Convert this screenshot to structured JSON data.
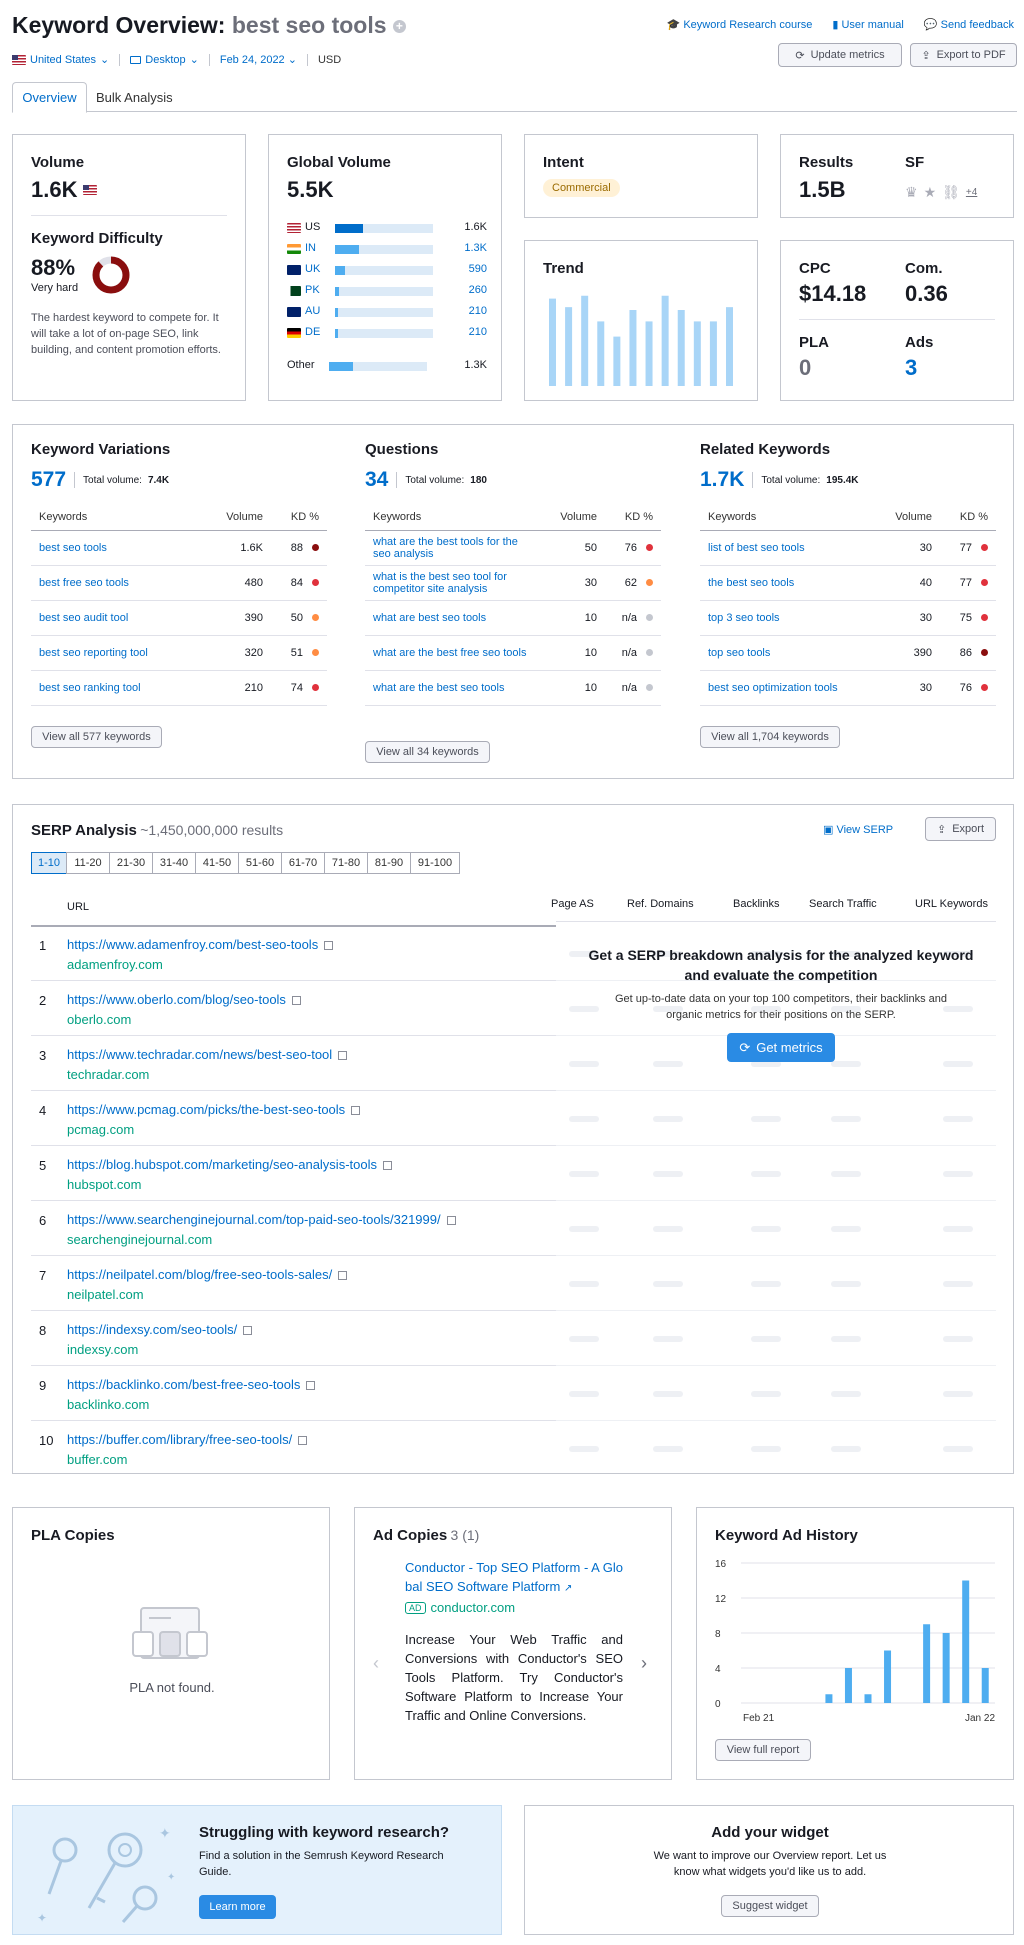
{
  "header": {
    "title_prefix": "Keyword Overview:",
    "keyword": "best seo tools",
    "links": {
      "course": "Keyword Research course",
      "manual": "User manual",
      "feedback": "Send feedback"
    },
    "filters": {
      "country": "United States",
      "device": "Desktop",
      "date": "Feb 24, 2022",
      "currency": "USD"
    },
    "buttons": {
      "update": "Update metrics",
      "export": "Export to PDF"
    },
    "tabs": [
      "Overview",
      "Bulk Analysis"
    ]
  },
  "volume": {
    "label": "Volume",
    "value": "1.6K",
    "kd_label": "Keyword Difficulty",
    "kd_value": "88%",
    "kd_level": "Very hard",
    "kd_percent": 88,
    "kd_desc": "The hardest keyword to compete for. It will take a lot of on-page SEO, link building, and content promotion efforts."
  },
  "global_volume": {
    "label": "Global Volume",
    "value": "5.5K",
    "countries": [
      {
        "code": "US",
        "value": "1.6K",
        "fill": 0.29,
        "link": false
      },
      {
        "code": "IN",
        "value": "1.3K",
        "fill": 0.24,
        "link": true
      },
      {
        "code": "UK",
        "value": "590",
        "fill": 0.1,
        "link": true
      },
      {
        "code": "PK",
        "value": "260",
        "fill": 0.04,
        "link": true
      },
      {
        "code": "AU",
        "value": "210",
        "fill": 0.035,
        "link": true
      },
      {
        "code": "DE",
        "value": "210",
        "fill": 0.035,
        "link": true
      }
    ],
    "other_label": "Other",
    "other_value": "1.3K",
    "other_fill": 0.24
  },
  "intent": {
    "label": "Intent",
    "badge": "Commercial"
  },
  "results": {
    "label": "Results",
    "value": "1.5B",
    "sf_label": "SF",
    "sf_more": "+4"
  },
  "trend": {
    "label": "Trend",
    "values": [
      0.92,
      0.83,
      0.95,
      0.68,
      0.52,
      0.8,
      0.68,
      0.95,
      0.8,
      0.68,
      0.68,
      0.83
    ]
  },
  "cpc": {
    "cpc_label": "CPC",
    "cpc_value": "$14.18",
    "com_label": "Com.",
    "com_value": "0.36",
    "pla_label": "PLA",
    "pla_value": "0",
    "ads_label": "Ads",
    "ads_value": "3"
  },
  "variations": {
    "label": "Keyword Variations",
    "count": "577",
    "total_label": "Total volume:",
    "total": "7.4K",
    "cols": [
      "Keywords",
      "Volume",
      "KD %"
    ],
    "rows": [
      {
        "k": "best seo tools",
        "v": "1.6K",
        "d": "88",
        "c": "#8A0E0E"
      },
      {
        "k": "best free seo tools",
        "v": "480",
        "d": "84",
        "c": "#E0323C"
      },
      {
        "k": "best seo audit tool",
        "v": "390",
        "d": "50",
        "c": "#FF8C43"
      },
      {
        "k": "best seo reporting tool",
        "v": "320",
        "d": "51",
        "c": "#FF8C43"
      },
      {
        "k": "best seo ranking tool",
        "v": "210",
        "d": "74",
        "c": "#E0323C"
      }
    ],
    "view_all": "View all 577 keywords"
  },
  "questions": {
    "label": "Questions",
    "count": "34",
    "total_label": "Total volume:",
    "total": "180",
    "cols": [
      "Keywords",
      "Volume",
      "KD %"
    ],
    "rows": [
      {
        "k": "what are the best tools for the seo analysis",
        "v": "50",
        "d": "76",
        "c": "#E0323C"
      },
      {
        "k": "what is the best seo tool for competitor site analysis",
        "v": "30",
        "d": "62",
        "c": "#FF8C43"
      },
      {
        "k": "what are best seo tools",
        "v": "10",
        "d": "n/a",
        "c": "#C4C7CF"
      },
      {
        "k": "what are the best free seo tools",
        "v": "10",
        "d": "n/a",
        "c": "#C4C7CF"
      },
      {
        "k": "what are the best seo tools",
        "v": "10",
        "d": "n/a",
        "c": "#C4C7CF"
      }
    ],
    "view_all": "View all 34 keywords"
  },
  "related": {
    "label": "Related Keywords",
    "count": "1.7K",
    "total_label": "Total volume:",
    "total": "195.4K",
    "cols": [
      "Keywords",
      "Volume",
      "KD %"
    ],
    "rows": [
      {
        "k": "list of best seo tools",
        "v": "30",
        "d": "77",
        "c": "#E0323C"
      },
      {
        "k": "the best seo tools",
        "v": "40",
        "d": "77",
        "c": "#E0323C"
      },
      {
        "k": "top 3 seo tools",
        "v": "30",
        "d": "75",
        "c": "#E0323C"
      },
      {
        "k": "top seo tools",
        "v": "390",
        "d": "86",
        "c": "#8A0E0E"
      },
      {
        "k": "best seo optimization tools",
        "v": "30",
        "d": "76",
        "c": "#E0323C"
      }
    ],
    "view_all": "View all 1,704 keywords"
  },
  "serp": {
    "label": "SERP Analysis",
    "results": "~1,450,000,000 results",
    "view_serp": "View SERP",
    "export": "Export",
    "pages": [
      "1-10",
      "11-20",
      "21-30",
      "31-40",
      "41-50",
      "51-60",
      "61-70",
      "71-80",
      "81-90",
      "91-100"
    ],
    "cols": [
      "URL",
      "Page AS",
      "Ref. Domains",
      "Backlinks",
      "Search Traffic",
      "URL Keywords"
    ],
    "rows": [
      {
        "n": "1",
        "url": "https://www.adamenfroy.com/best-seo-tools",
        "domain": "adamenfroy.com"
      },
      {
        "n": "2",
        "url": "https://www.oberlo.com/blog/seo-tools",
        "domain": "oberlo.com"
      },
      {
        "n": "3",
        "url": "https://www.techradar.com/news/best-seo-tool",
        "domain": "techradar.com"
      },
      {
        "n": "4",
        "url": "https://www.pcmag.com/picks/the-best-seo-tools",
        "domain": "pcmag.com"
      },
      {
        "n": "5",
        "url": "https://blog.hubspot.com/marketing/seo-analysis-tools",
        "domain": "hubspot.com"
      },
      {
        "n": "6",
        "url": "https://www.searchenginejournal.com/top-paid-seo-tools/321999/",
        "domain": "searchenginejournal.com"
      },
      {
        "n": "7",
        "url": "https://neilpatel.com/blog/free-seo-tools-sales/",
        "domain": "neilpatel.com"
      },
      {
        "n": "8",
        "url": "https://indexsy.com/seo-tools/",
        "domain": "indexsy.com"
      },
      {
        "n": "9",
        "url": "https://backlinko.com/best-free-seo-tools",
        "domain": "backlinko.com"
      },
      {
        "n": "10",
        "url": "https://buffer.com/library/free-seo-tools/",
        "domain": "buffer.com"
      }
    ],
    "overlay_title": "Get a SERP breakdown analysis for the analyzed keyword and evaluate the competition",
    "overlay_text": "Get up-to-date data on your top 100 competitors, their backlinks and organic metrics for their positions on the SERP.",
    "overlay_button": "Get metrics"
  },
  "pla": {
    "label": "PLA Copies",
    "empty": "PLA not found."
  },
  "ad_copies": {
    "label": "Ad Copies",
    "count": "3 (1)",
    "ad_title": "Conductor - Top SEO Platform - A Global SEO Software Platform",
    "ad_badge": "AD",
    "ad_domain": "conductor.com",
    "ad_text": "Increase Your Web Traffic and Conversions with Conductor's SEO Tools Platform. Try Conductor's Software Platform to Increase Your Traffic and Online Conversions."
  },
  "ad_history": {
    "label": "Keyword Ad History",
    "view_full": "View full report"
  },
  "chart_data": {
    "type": "bar",
    "title": "Keyword Ad History",
    "x_start_label": "Feb 21",
    "x_end_label": "Jan 22",
    "values": [
      0,
      0,
      0,
      0,
      1,
      4,
      1,
      6,
      0,
      9,
      8,
      14,
      4
    ],
    "yticks": [
      "0",
      "4",
      "8",
      "12",
      "16"
    ],
    "ylim": [
      0,
      16
    ],
    "color": "#4EADF0"
  },
  "promo": {
    "title": "Struggling with keyword research?",
    "text": "Find a solution in the Semrush Keyword Research Guide.",
    "button": "Learn more"
  },
  "widget": {
    "title": "Add your widget",
    "text": "We want to improve our Overview report. Let us know what widgets you'd like us to add.",
    "button": "Suggest widget"
  }
}
